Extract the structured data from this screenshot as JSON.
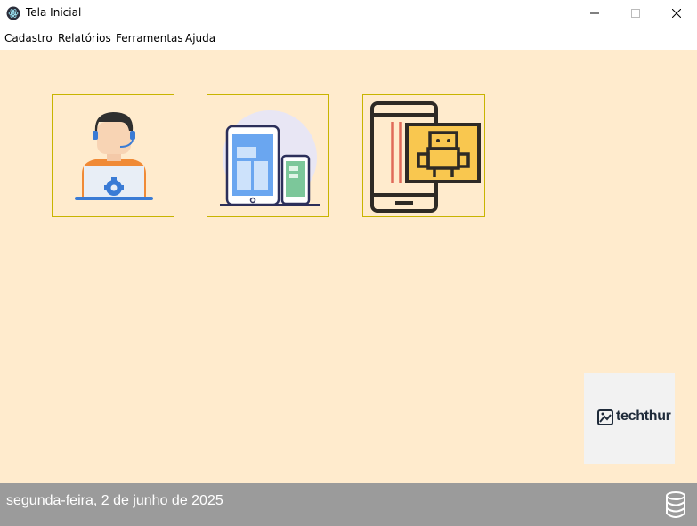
{
  "window": {
    "title": "Tela Inicial",
    "icon": "electron-atom-icon"
  },
  "menu": [
    "Cadastro",
    "Relatórios",
    "Ferramentas",
    "Ajuda"
  ],
  "tiles": [
    {
      "name": "support-agent-icon"
    },
    {
      "name": "responsive-devices-icon"
    },
    {
      "name": "mobile-robot-icon"
    }
  ],
  "logo": {
    "text": "techthur"
  },
  "status": {
    "date": "segunda-feira, 2 de junho de 2025",
    "icon": "database-icon"
  },
  "colors": {
    "background": "#ffebcd",
    "tile_border": "#c8b400",
    "statusbar": "#9b9b9b"
  }
}
